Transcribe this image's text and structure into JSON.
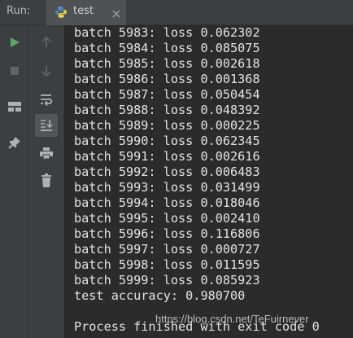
{
  "header": {
    "run_label": "Run:",
    "tab_label": "test"
  },
  "toolbar": {
    "left_icons": [
      "run-icon",
      "stop-icon",
      "layout-icon",
      "pin-icon"
    ],
    "right_icons": [
      "up-arrow-icon",
      "down-arrow-icon",
      "soft-wrap-icon",
      "scroll-to-end-icon",
      "print-icon",
      "trash-icon"
    ]
  },
  "console": {
    "lines": [
      "batch 5983: loss 0.062302",
      "batch 5984: loss 0.085075",
      "batch 5985: loss 0.002618",
      "batch 5986: loss 0.001368",
      "batch 5987: loss 0.050454",
      "batch 5988: loss 0.048392",
      "batch 5989: loss 0.000225",
      "batch 5990: loss 0.062345",
      "batch 5991: loss 0.002616",
      "batch 5992: loss 0.006483",
      "batch 5993: loss 0.031499",
      "batch 5994: loss 0.018046",
      "batch 5995: loss 0.002410",
      "batch 5996: loss 0.116806",
      "batch 5997: loss 0.000727",
      "batch 5998: loss 0.011595",
      "batch 5999: loss 0.085923",
      "test accuracy: 0.980700",
      "",
      "Process finished with exit code 0"
    ]
  },
  "watermark": "https://blog.csdn.net/TeFuirnever",
  "colors": {
    "background": "#2b2b2b",
    "toolbar": "#3c3f41",
    "text": "#e3e3e3",
    "run_green": "#59a869"
  }
}
